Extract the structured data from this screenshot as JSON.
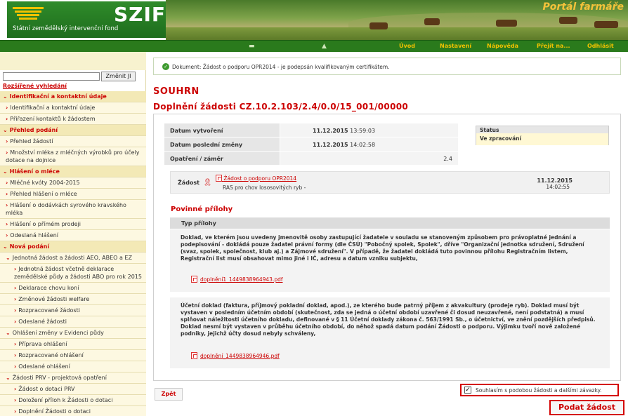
{
  "header": {
    "logo": "SZIF",
    "logo_subtitle": "Státní zemědělský intervenční fond",
    "portal_title": "Portál farmáře"
  },
  "topnav": {
    "items": [
      "Úvod",
      "Nastavení",
      "Nápověda",
      "Přejít na...",
      "Odhlásit"
    ]
  },
  "sidebar": {
    "search_value": "",
    "search_button": "Změnit JI",
    "advanced_search": "Rozšířené vyhledání",
    "menu": [
      {
        "label": "Identifikační a kontaktní údaje",
        "type": "section",
        "arrow": "⌄"
      },
      {
        "label": "Identifikační a kontaktní údaje",
        "type": "item",
        "arrow": "›"
      },
      {
        "label": "Přiřazení kontaktů k žádostem",
        "type": "item",
        "arrow": "›"
      },
      {
        "label": "Přehled podání",
        "type": "section",
        "arrow": "⌄"
      },
      {
        "label": "Přehled žádostí",
        "type": "item",
        "arrow": "›"
      },
      {
        "label": "Množství mléka z mléčných výrobků pro účely dotace na dojnice",
        "type": "item",
        "arrow": "›"
      },
      {
        "label": "Hlášení o mléce",
        "type": "section",
        "arrow": "⌄"
      },
      {
        "label": "Mléčné kvóty 2004-2015",
        "type": "item",
        "arrow": "›"
      },
      {
        "label": "Přehled hlášení o mléce",
        "type": "item",
        "arrow": "›"
      },
      {
        "label": "Hlášení o dodávkách syrového kravského mléka",
        "type": "item",
        "arrow": "›"
      },
      {
        "label": "Hlášení o přímém prodeji",
        "type": "item",
        "arrow": "›"
      },
      {
        "label": "Odeslaná hlášení",
        "type": "item",
        "arrow": "›"
      },
      {
        "label": "Nová podání",
        "type": "section",
        "arrow": "⌄"
      },
      {
        "label": "Jednotná žádost a žádosti AEO, ABEO a EZ",
        "type": "sub",
        "arrow": "⌄"
      },
      {
        "label": "Jednotná žádost včetně deklarace zemědělské půdy a žádosti ABO pro rok 2015",
        "type": "sub2",
        "arrow": "›"
      },
      {
        "label": "Deklarace chovu koní",
        "type": "sub2",
        "arrow": "›"
      },
      {
        "label": "Změnové žádosti welfare",
        "type": "sub2",
        "arrow": "›"
      },
      {
        "label": "Rozpracované žádosti",
        "type": "sub2",
        "arrow": "›"
      },
      {
        "label": "Odeslané žádosti",
        "type": "sub2",
        "arrow": "›"
      },
      {
        "label": "Ohlášení změny v Evidenci půdy",
        "type": "sub",
        "arrow": "⌄"
      },
      {
        "label": "Příprava ohlášení",
        "type": "sub2",
        "arrow": "›"
      },
      {
        "label": "Rozpracované ohlášení",
        "type": "sub2",
        "arrow": "›"
      },
      {
        "label": "Odeslané ohlášení",
        "type": "sub2",
        "arrow": "›"
      },
      {
        "label": "Žádosti PRV - projektová opatření",
        "type": "sub",
        "arrow": "⌄"
      },
      {
        "label": "Žádost o dotaci PRV",
        "type": "sub2",
        "arrow": "›"
      },
      {
        "label": "Doložení příloh k Žádosti o dotaci",
        "type": "sub2",
        "arrow": "›"
      },
      {
        "label": "Doplnění Žádosti o dotaci",
        "type": "sub2",
        "arrow": "›"
      }
    ]
  },
  "main": {
    "notice": "Dokument: Žádost o podporu OPR2014 - je podepsán kvalifikovaným certifikátem.",
    "title": "SOUHRN",
    "subtitle": "Doplnění žádosti CZ.10.2.103/2.4/0.0/15_001/00000",
    "info": [
      {
        "label": "Datum vytvoření",
        "value_date": "11.12.2015",
        "value_time": "13:59:03"
      },
      {
        "label": "Datum poslední změny",
        "value_date": "11.12.2015",
        "value_time": "14:02:58"
      },
      {
        "label": "Opatření / záměr",
        "value": "2.4"
      }
    ],
    "status": {
      "label": "Status",
      "value": "Ve zpracování"
    },
    "zadost": {
      "label": "Žádost",
      "link": "Žádost o podporu OPR2014",
      "desc": "RAS pro chov lososovitých ryb -",
      "date": "11.12.2015",
      "time": "14:02:55"
    },
    "prilohy_title": "Povinné přílohy",
    "prilohy_header": "Typ přílohy",
    "prilohy": [
      {
        "text": "Doklad, ve kterém jsou uvedeny jmenovitě osoby zastupující žadatele v souladu se stanoveným způsobem pro právoplatné jednání a podepisování - dokládá pouze žadatel právní formy (dle ČSÚ) \"Pobočný spolek, Spolek\", dříve \"Organizační jednotka sdružení, Sdružení (svaz, spolek, společnost, klub aj.) a Zájmové sdružení\". V případě, že žadatel dokládá tuto povinnou přílohu Registračním listem, Registrační list musí obsahovat mimo jiné i IČ, adresu a datum vzniku subjektu,",
        "file": "doplnění1_1449838964943.pdf"
      },
      {
        "text": "Účetní doklad (faktura, příjmový pokladní doklad, apod.), ze kterého bude patrný příjem z akvakultury (prodeje ryb). Doklad musí být vystaven v posledním účetním období (skutečnost, zda se jedná o účetní období uzavřené či dosud neuzavřené, není podstatná) a musí splňovat náležitosti účetního dokladu, definované v § 11 Účetní doklady zákona č. 563/1991 Sb., o účetnictví, ve znění pozdějších předpisů. Doklad nesmí být vystaven v průběhu účetního období, do něhož spadá datum podání Žádosti o podporu. Výjimku tvoří nově založené podniky, jejichž účty dosud nebyly schváleny,",
        "file": "doplnění_1449838964946.pdf"
      }
    ],
    "back_button": "Zpět",
    "agree_label": "Souhlasím s podobou žádosti a dalšími závazky.",
    "agree_checked": true,
    "submit_button": "Podat žádost"
  },
  "colors": {
    "accent_red": "#cc0000",
    "nav_green": "#2a7a1c",
    "nav_text": "#f2c200",
    "sidebar_bg": "#fdf8e1"
  }
}
